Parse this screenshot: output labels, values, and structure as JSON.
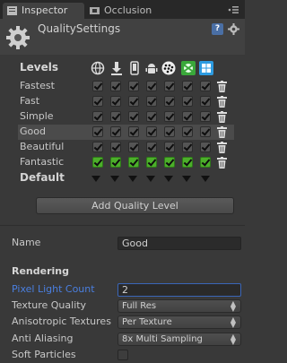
{
  "tabs": [
    {
      "label": "Inspector",
      "icon": "inspector-icon"
    },
    {
      "label": "Occlusion",
      "icon": "occlusion-icon"
    }
  ],
  "header": {
    "title": "QualitySettings",
    "icon": "gear-icon"
  },
  "levels": {
    "title": "Levels",
    "platforms": [
      "web-icon",
      "standalone-download-icon",
      "iphone-icon",
      "android-icon",
      "blackberry-icon",
      "xbox-icon",
      "windows-store-icon"
    ],
    "rows": [
      {
        "name": "Fastest"
      },
      {
        "name": "Fast"
      },
      {
        "name": "Simple"
      },
      {
        "name": "Good",
        "selected": true
      },
      {
        "name": "Beautiful"
      },
      {
        "name": "Fantastic"
      }
    ],
    "default_label": "Default",
    "add_button": "Add Quality Level"
  },
  "properties": {
    "name_label": "Name",
    "name_value": "Good",
    "section_title": "Rendering",
    "pixel_light_count_label": "Pixel Light Count",
    "pixel_light_count_value": "2",
    "texture_quality_label": "Texture Quality",
    "texture_quality_value": "Full Res",
    "anisotropic_label": "Anisotropic Textures",
    "anisotropic_value": "Per Texture",
    "anti_aliasing_label": "Anti Aliasing",
    "anti_aliasing_value": "8x Multi Sampling",
    "soft_particles_label": "Soft Particles"
  },
  "colors": {
    "focus_label": "#4a7fe0",
    "green_check": "#4caf2a"
  }
}
